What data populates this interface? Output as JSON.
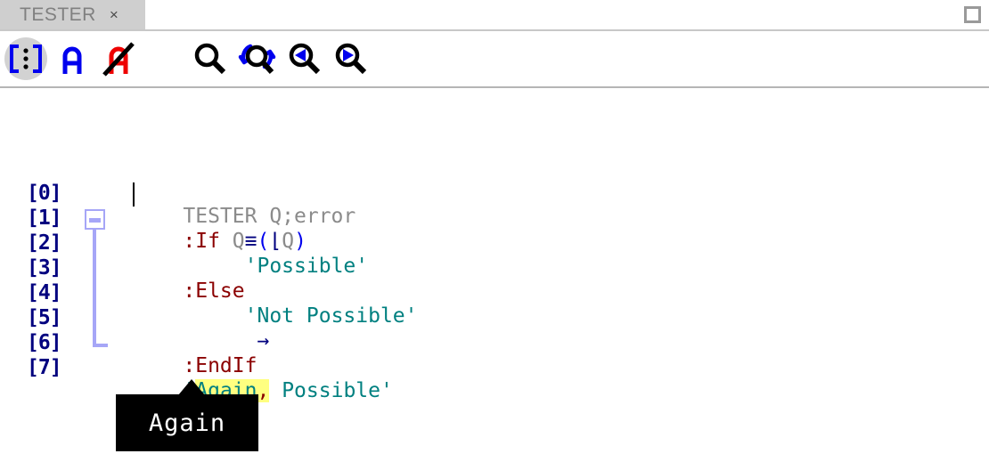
{
  "window": {
    "restore_button_name": "restore",
    "tab": {
      "label": "TESTER",
      "close_label": "×"
    }
  },
  "toolbar": {
    "items": [
      {
        "name": "line-numbers-icon",
        "title": "[ ⋮ ]",
        "active": true
      },
      {
        "name": "show-apl-chars-icon",
        "title": "A",
        "active": false
      },
      {
        "name": "hide-apl-chars-icon",
        "title": "A-slashed",
        "active": false
      },
      {
        "name": "search-icon",
        "title": "Search",
        "active": false
      },
      {
        "name": "search-replace-icon",
        "title": "Search again",
        "active": false
      },
      {
        "name": "search-prev-icon",
        "title": "Find previous",
        "active": false
      },
      {
        "name": "search-next-icon",
        "title": "Find next",
        "active": false
      }
    ],
    "colors": {
      "accent_blue": "#0000ee",
      "accent_red": "#ee0000",
      "glyph_black": "#000000",
      "active_bg": "#d2d2d2"
    }
  },
  "editor": {
    "line_numbers": [
      "[0]",
      "[1]",
      "[2]",
      "[3]",
      "[4]",
      "[5]",
      "[6]",
      "[7]"
    ],
    "lines": [
      {
        "n": "[0]",
        "text": "TESTER Q;error"
      },
      {
        "n": "[1]",
        "text": ":If Q≡(⌊Q)"
      },
      {
        "n": "[2]",
        "text": "     'Possible'"
      },
      {
        "n": "[3]",
        "text": ":Else"
      },
      {
        "n": "[4]",
        "text": "     'Not Possible'"
      },
      {
        "n": "[5]",
        "text": "      →"
      },
      {
        "n": "[6]",
        "text": ":EndIf"
      },
      {
        "n": "[7]",
        "text": "'Again, Possible'"
      }
    ],
    "tokens": {
      "l0_header": "TESTER Q;error",
      "l1_if": ":If ",
      "l1_q1": "Q",
      "l1_match": "≡",
      "l1_open": "(",
      "l1_floor": "⌊",
      "l1_q2": "Q",
      "l1_close": ")",
      "l2_indent": "     ",
      "l2_string": "'Possible'",
      "l3_else": ":Else",
      "l4_indent": "     ",
      "l4_string": "'Not Possible'",
      "l5_indent": "      ",
      "l5_arrow": "→",
      "l6_endif": ":EndIf",
      "l7_quote_open": "'",
      "l7_highlight": "Again",
      "l7_comma": ",",
      "l7_rest": " Possible'"
    },
    "colors": {
      "line_number": "#00007f",
      "header_text": "#8b8b8b",
      "keyword": "#8b0000",
      "string": "#008080",
      "primitive": "#00007f",
      "paren": "#0000ee",
      "highlight_bg": "#ffff80",
      "fold_marker": "#a6a6f7"
    },
    "fold": {
      "marker": "−",
      "start_line": "[1]",
      "end_line": "[6]"
    }
  },
  "tooltip": {
    "text": "Again",
    "bg": "#000000",
    "fg": "#ffffff"
  }
}
